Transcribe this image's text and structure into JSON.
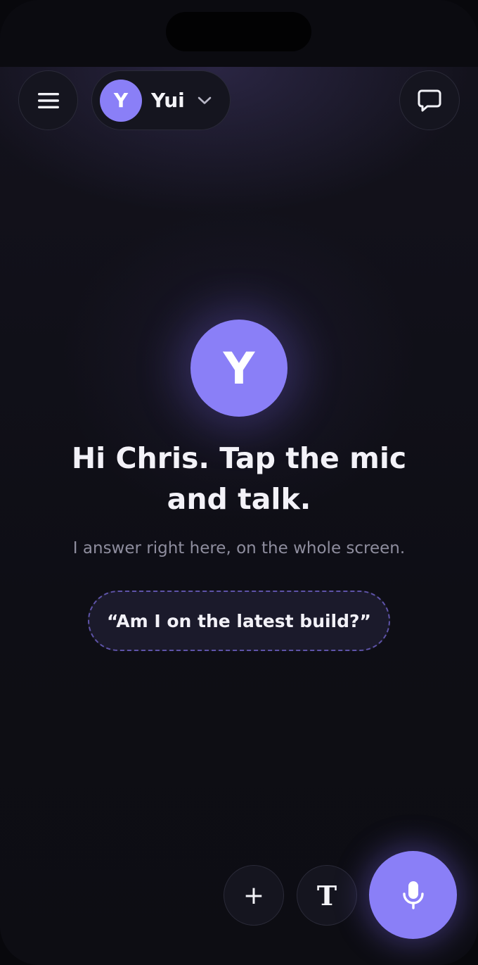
{
  "header": {
    "agent_initial": "Y",
    "agent_name": "Yui",
    "icons": {
      "menu": "hamburger-menu-icon",
      "chevron": "chevron-down-icon",
      "chat": "chat-bubble-icon"
    }
  },
  "hero": {
    "avatar_initial": "Y",
    "headline": "Hi Chris. Tap the mic and talk.",
    "subline": "I answer right here, on the whole screen."
  },
  "suggestion": {
    "label": "“Am I on the latest build?”"
  },
  "toolbar": {
    "plus_label": "+",
    "text_label": "T",
    "icons": {
      "plus": "plus-icon",
      "text": "text-icon",
      "mic": "microphone-icon"
    }
  },
  "colors": {
    "accent": "#8a7ff7",
    "background": "#0f0f17",
    "text_primary": "#f3f2f8",
    "text_secondary": "#8e8d9e",
    "suggestion_border": "#5e53a8"
  }
}
